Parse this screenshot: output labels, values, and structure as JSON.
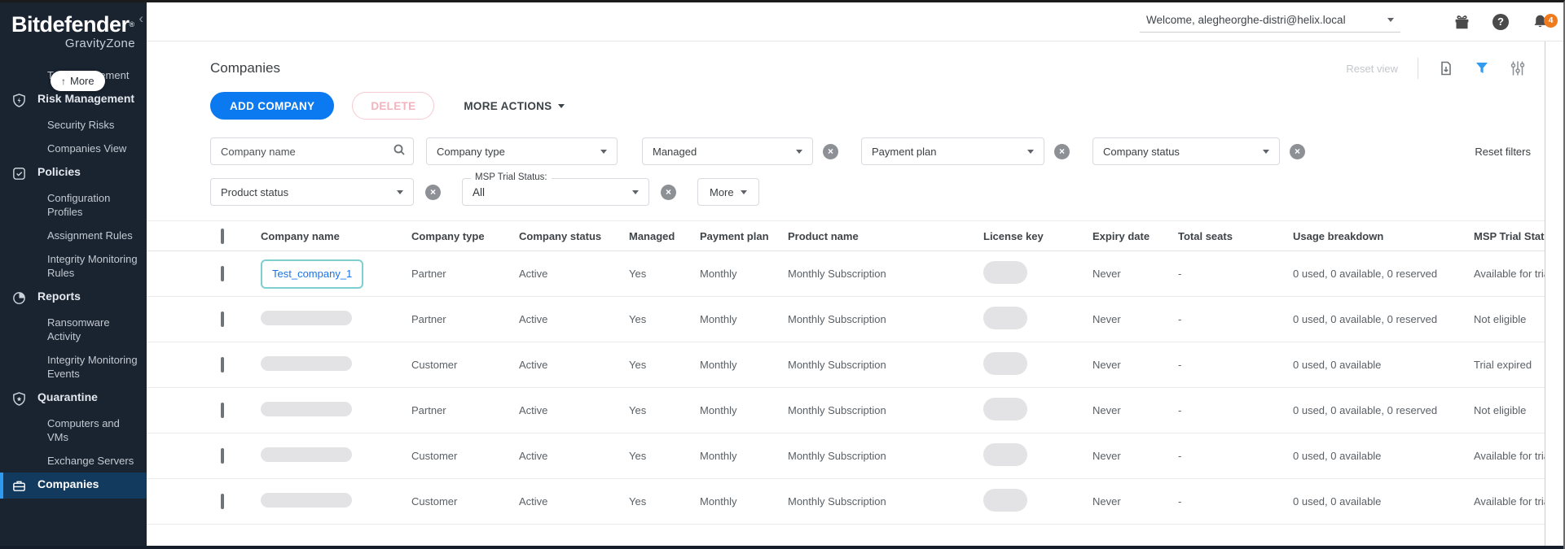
{
  "brand": {
    "name": "Bitdefender",
    "reg": "®",
    "product": "GravityZone"
  },
  "header": {
    "welcome": "Welcome, alegheorghe-distri@helix.local",
    "notifications_count": "4"
  },
  "sidebar": {
    "more_label": "More",
    "items": [
      {
        "label": "Tag Management",
        "type": "sub"
      },
      {
        "label": "Risk Management",
        "type": "top",
        "icon": "shield-lightning-icon"
      },
      {
        "label": "Security Risks",
        "type": "sub"
      },
      {
        "label": "Companies View",
        "type": "sub"
      },
      {
        "label": "Policies",
        "type": "top",
        "icon": "check-square-icon"
      },
      {
        "label": "Configuration Profiles",
        "type": "sub"
      },
      {
        "label": "Assignment Rules",
        "type": "sub"
      },
      {
        "label": "Integrity Monitoring Rules",
        "type": "sub"
      },
      {
        "label": "Reports",
        "type": "top",
        "icon": "pie-chart-icon"
      },
      {
        "label": "Ransomware Activity",
        "type": "sub"
      },
      {
        "label": "Integrity Monitoring Events",
        "type": "sub"
      },
      {
        "label": "Quarantine",
        "type": "top",
        "icon": "shield-star-icon"
      },
      {
        "label": "Computers and VMs",
        "type": "sub"
      },
      {
        "label": "Exchange Servers",
        "type": "sub"
      },
      {
        "label": "Companies",
        "type": "top",
        "icon": "briefcase-icon",
        "active": true
      }
    ]
  },
  "page": {
    "title": "Companies",
    "reset_view_label": "Reset view"
  },
  "actions": {
    "add_company": "ADD COMPANY",
    "delete": "DELETE",
    "more_actions": "MORE ACTIONS"
  },
  "filters": {
    "company_name_placeholder": "Company name",
    "company_type": "Company type",
    "managed": "Managed",
    "payment_plan": "Payment plan",
    "company_status": "Company status",
    "product_status": "Product status",
    "msp_trial_label": "MSP Trial Status:",
    "msp_trial_value": "All",
    "more": "More",
    "reset_filters": "Reset filters"
  },
  "table": {
    "columns": [
      "Company name",
      "Company type",
      "Company status",
      "Managed",
      "Payment plan",
      "Product name",
      "License key",
      "Expiry date",
      "Total seats",
      "Usage breakdown",
      "MSP Trial Status"
    ],
    "rows": [
      {
        "name": "Test_company_1",
        "type": "Partner",
        "status": "Active",
        "managed": "Yes",
        "payment": "Monthly",
        "product": "Monthly Subscription",
        "expiry": "Never",
        "seats": "-",
        "usage": "0 used, 0 available, 0 reserved",
        "msp": "Available for trial"
      },
      {
        "name": "",
        "type": "Partner",
        "status": "Active",
        "managed": "Yes",
        "payment": "Monthly",
        "product": "Monthly Subscription",
        "expiry": "Never",
        "seats": "-",
        "usage": "0 used, 0 available, 0 reserved",
        "msp": "Not eligible"
      },
      {
        "name": "",
        "type": "Customer",
        "status": "Active",
        "managed": "Yes",
        "payment": "Monthly",
        "product": "Monthly Subscription",
        "expiry": "Never",
        "seats": "-",
        "usage": "0 used, 0 available",
        "msp": "Trial expired"
      },
      {
        "name": "",
        "type": "Partner",
        "status": "Active",
        "managed": "Yes",
        "payment": "Monthly",
        "product": "Monthly Subscription",
        "expiry": "Never",
        "seats": "-",
        "usage": "0 used, 0 available, 0 reserved",
        "msp": "Not eligible"
      },
      {
        "name": "",
        "type": "Customer",
        "status": "Active",
        "managed": "Yes",
        "payment": "Monthly",
        "product": "Monthly Subscription",
        "expiry": "Never",
        "seats": "-",
        "usage": "0 used, 0 available",
        "msp": "Available for trial"
      },
      {
        "name": "",
        "type": "Customer",
        "status": "Active",
        "managed": "Yes",
        "payment": "Monthly",
        "product": "Monthly Subscription",
        "expiry": "Never",
        "seats": "-",
        "usage": "0 used, 0 available",
        "msp": "Available for trial"
      }
    ]
  },
  "colors": {
    "sidebar_bg": "#1a2431",
    "active_item_bg": "#123a5e",
    "active_item_border": "#2e9bf0",
    "primary_button": "#0b79f0",
    "link_blue": "#1a73e8",
    "delete_pink": "#f3b3bc",
    "badge_orange": "#f07b1d",
    "filter_funnel_blue": "#2f9bf2",
    "focus_teal": "#7fced0"
  }
}
